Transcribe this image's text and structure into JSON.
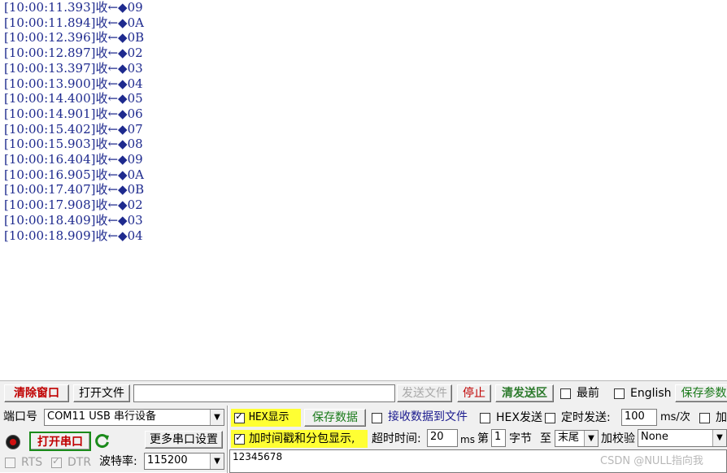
{
  "log": {
    "lines": [
      "[10:00:11.393]收←◆09",
      "[10:00:11.894]收←◆0A",
      "[10:00:12.396]收←◆0B",
      "[10:00:12.897]收←◆02",
      "[10:00:13.397]收←◆03",
      "[10:00:13.900]收←◆04",
      "[10:00:14.400]收←◆05",
      "[10:00:14.901]收←◆06",
      "[10:00:15.402]收←◆07",
      "[10:00:15.903]收←◆08",
      "[10:00:16.404]收←◆09",
      "[10:00:16.905]收←◆0A",
      "[10:00:17.407]收←◆0B",
      "[10:00:17.908]收←◆02",
      "[10:00:18.409]收←◆03",
      "[10:00:18.909]收←◆04"
    ]
  },
  "toolbar": {
    "clear_window": "清除窗口",
    "open_file": "打开文件",
    "file_path": "",
    "send_file": "发送文件",
    "stop": "停止",
    "clear_send": "清发送区",
    "topmost_label": "最前",
    "english_label": "English",
    "save_params": "保存参数"
  },
  "serial": {
    "port_label": "端口号",
    "port_value": "COM11 USB 串行设备",
    "open_port": "打开串口",
    "more_settings": "更多串口设置",
    "rts_label": "RTS",
    "dtr_label": "DTR",
    "baud_label": "波特率:",
    "baud_value": "115200"
  },
  "options": {
    "hex_display": "HEX显示",
    "save_data": "保存数据",
    "recv_to_file": "接收数据到文件",
    "hex_send": "HEX发送",
    "timed_send": "定时发送:",
    "timed_value": "100",
    "timed_unit": "ms/次",
    "add_label": "加",
    "timestamp": "加时间戳和分包显示,",
    "timeout_label": "超时时间:",
    "timeout_value": "20",
    "timeout_unit": "ms",
    "nth_label": "第",
    "nth_value": "1",
    "byte_label": "字节",
    "to_label": "至",
    "to_value": "末尾",
    "checksum_label": "加校验",
    "checksum_value": "None"
  },
  "send_area": {
    "text": "12345678"
  },
  "watermark": "CSDN @NULL指向我",
  "colors": {
    "log_text": "#1e2a8e",
    "red_button": "#c00000",
    "green_button": "#1a7a1a",
    "highlight": "#ffff33"
  }
}
